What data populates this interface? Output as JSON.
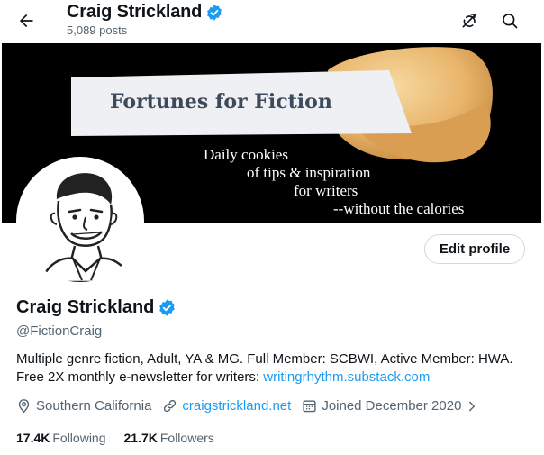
{
  "header": {
    "title": "Craig Strickland",
    "posts": "5,089 posts",
    "icons": [
      "back-arrow-icon",
      "no-notifications-icon",
      "search-icon"
    ]
  },
  "banner": {
    "heading": "Fortunes for Fiction",
    "lines": [
      "Daily cookies",
      "of tips & inspiration",
      "for writers",
      "--without the calories"
    ]
  },
  "profile": {
    "name": "Craig Strickland",
    "handle": "@FictionCraig",
    "edit_label": "Edit profile",
    "bio_text": "Multiple genre fiction, Adult, YA & MG. Full Member: SCBWI, Active Member: HWA. Free 2X monthly e-newsletter for writers: ",
    "bio_link": "writingrhythm.substack.com",
    "location": "Southern California",
    "website": "craigstrickland.net",
    "joined": "Joined December 2020",
    "following_count": "17.4K",
    "following_label": "Following",
    "followers_count": "21.7K",
    "followers_label": "Followers"
  },
  "colors": {
    "accent": "#1d9bf0",
    "text": "#0f1419",
    "muted": "#536471",
    "border": "#cfd9de"
  }
}
